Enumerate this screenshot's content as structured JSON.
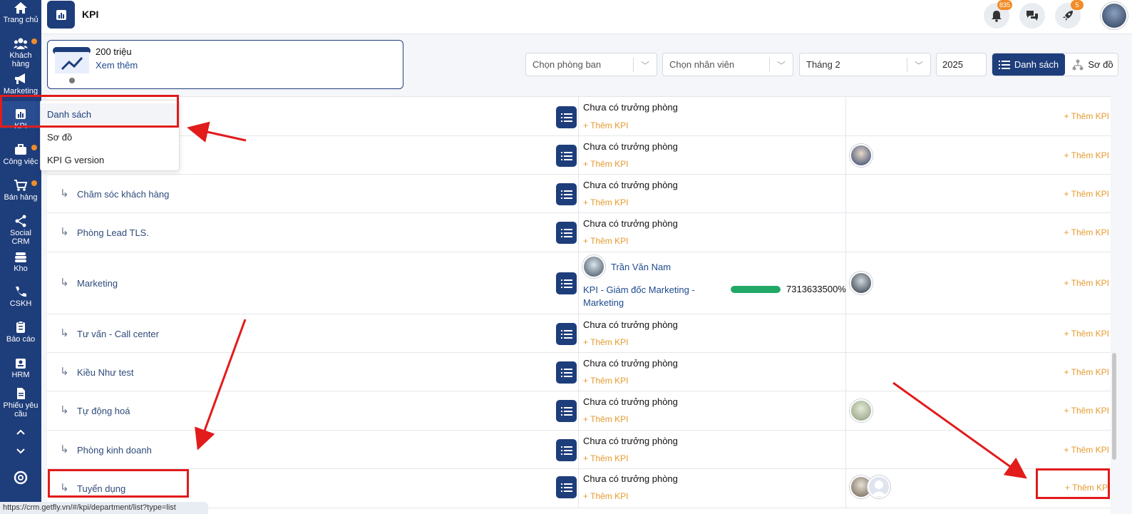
{
  "sidebar": {
    "items": [
      {
        "label": "Trang chủ",
        "icon": "home-icon"
      },
      {
        "label": "Khách hàng",
        "icon": "users-icon"
      },
      {
        "label": "Marketing",
        "icon": "megaphone-icon"
      },
      {
        "label": "KPI",
        "icon": "chart-icon"
      },
      {
        "label": "Công việc",
        "icon": "briefcase-icon"
      },
      {
        "label": "Bán hàng",
        "icon": "cart-icon"
      },
      {
        "label": "Social CRM",
        "icon": "share-icon"
      },
      {
        "label": "Kho",
        "icon": "warehouse-icon"
      },
      {
        "label": "CSKH",
        "icon": "phone-icon"
      },
      {
        "label": "Báo cáo",
        "icon": "report-icon"
      },
      {
        "label": "HRM",
        "icon": "id-card-icon"
      },
      {
        "label": "Phiếu yêu cầu",
        "icon": "document-icon"
      }
    ]
  },
  "header": {
    "title": "KPI",
    "notifications_count": "835",
    "rocket_count": "5"
  },
  "summary": {
    "value": "200 triệu",
    "more_link": "Xem thêm"
  },
  "filters": {
    "department_placeholder": "Chọn phòng ban",
    "employee_placeholder": "Chọn nhân viên",
    "month": "Tháng 2",
    "year": "2025"
  },
  "view_toggle": {
    "list_label": "Danh sách",
    "tree_label": "Sơ đồ"
  },
  "dropdown": {
    "items": [
      "Danh sách",
      "Sơ đồ",
      "KPI G version"
    ]
  },
  "table": {
    "no_leader": "Chưa có trưởng phòng",
    "add_kpi": "+ Thêm KPI",
    "rows": [
      {
        "dept": ""
      },
      {
        "dept": ""
      },
      {
        "dept": "Chăm sóc khách hàng"
      },
      {
        "dept": "Phòng Lead TLS."
      },
      {
        "dept": "Marketing",
        "leader": "Trần Văn Nam",
        "kpi_title": "KPI - Giám đốc Marketing - Marketing",
        "progress_pct": "7313633500%",
        "progress_fraction": 1.0
      },
      {
        "dept": "Tư vấn - Call center"
      },
      {
        "dept": "Kiều Như test"
      },
      {
        "dept": "Tự động hoá"
      },
      {
        "dept": "Phòng kinh doanh"
      },
      {
        "dept": "Tuyển dụng"
      }
    ],
    "last_add_kpi": "+ Thêm KP"
  },
  "statusbar": {
    "url": "https://crm.getfly.vn/#/kpi/department/list?type=list"
  },
  "colors": {
    "primary": "#1e3d7b",
    "accent": "#f28c28",
    "add_kpi": "#e69a2e",
    "progress": "#22a866",
    "annotation": "#e21b1b"
  }
}
